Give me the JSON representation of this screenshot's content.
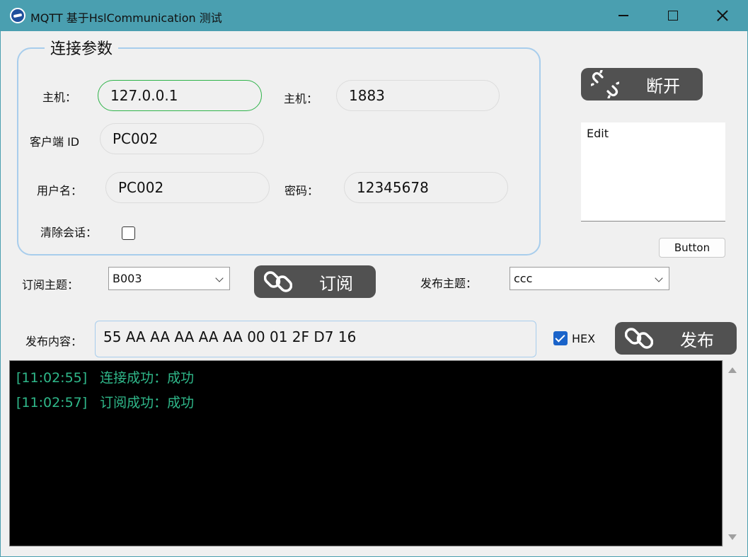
{
  "window": {
    "title": "MQTT 基于HslCommunication 测试"
  },
  "connection": {
    "group_title": "连接参数",
    "host_label": "主机：",
    "host_value": "127.0.0.1",
    "port_label": "主机：",
    "port_value": "1883",
    "client_id_label": "客户端 ID",
    "client_id_value": "PC002",
    "username_label": "用户名：",
    "username_value": "PC002",
    "password_label": "密码：",
    "password_value": "12345678",
    "clean_session_label": "清除会话："
  },
  "side": {
    "disconnect_label": "断开",
    "edit_text": "Edit",
    "button_label": "Button"
  },
  "subscribe": {
    "topic_label": "订阅主题：",
    "topic_value": "B003",
    "subscribe_label": "订阅"
  },
  "publish": {
    "topic_label": "发布主题：",
    "topic_value": "ccc",
    "content_label": "发布内容：",
    "content_value": "55 AA AA AA AA AA 00 01 2F D7 16",
    "hex_label": "HEX",
    "hex_checked": true,
    "publish_label": "发布"
  },
  "log": {
    "lines": [
      {
        "time": "[11:02:55]",
        "message": "连接成功：成功"
      },
      {
        "time": "[11:02:57]",
        "message": "订阅成功：成功"
      }
    ]
  },
  "colors": {
    "titlebar": "#4a9fb0",
    "log_text": "#2fb88a",
    "button_dark": "#515151",
    "focus_border": "#2fb34a",
    "group_border": "#a8cdec"
  }
}
